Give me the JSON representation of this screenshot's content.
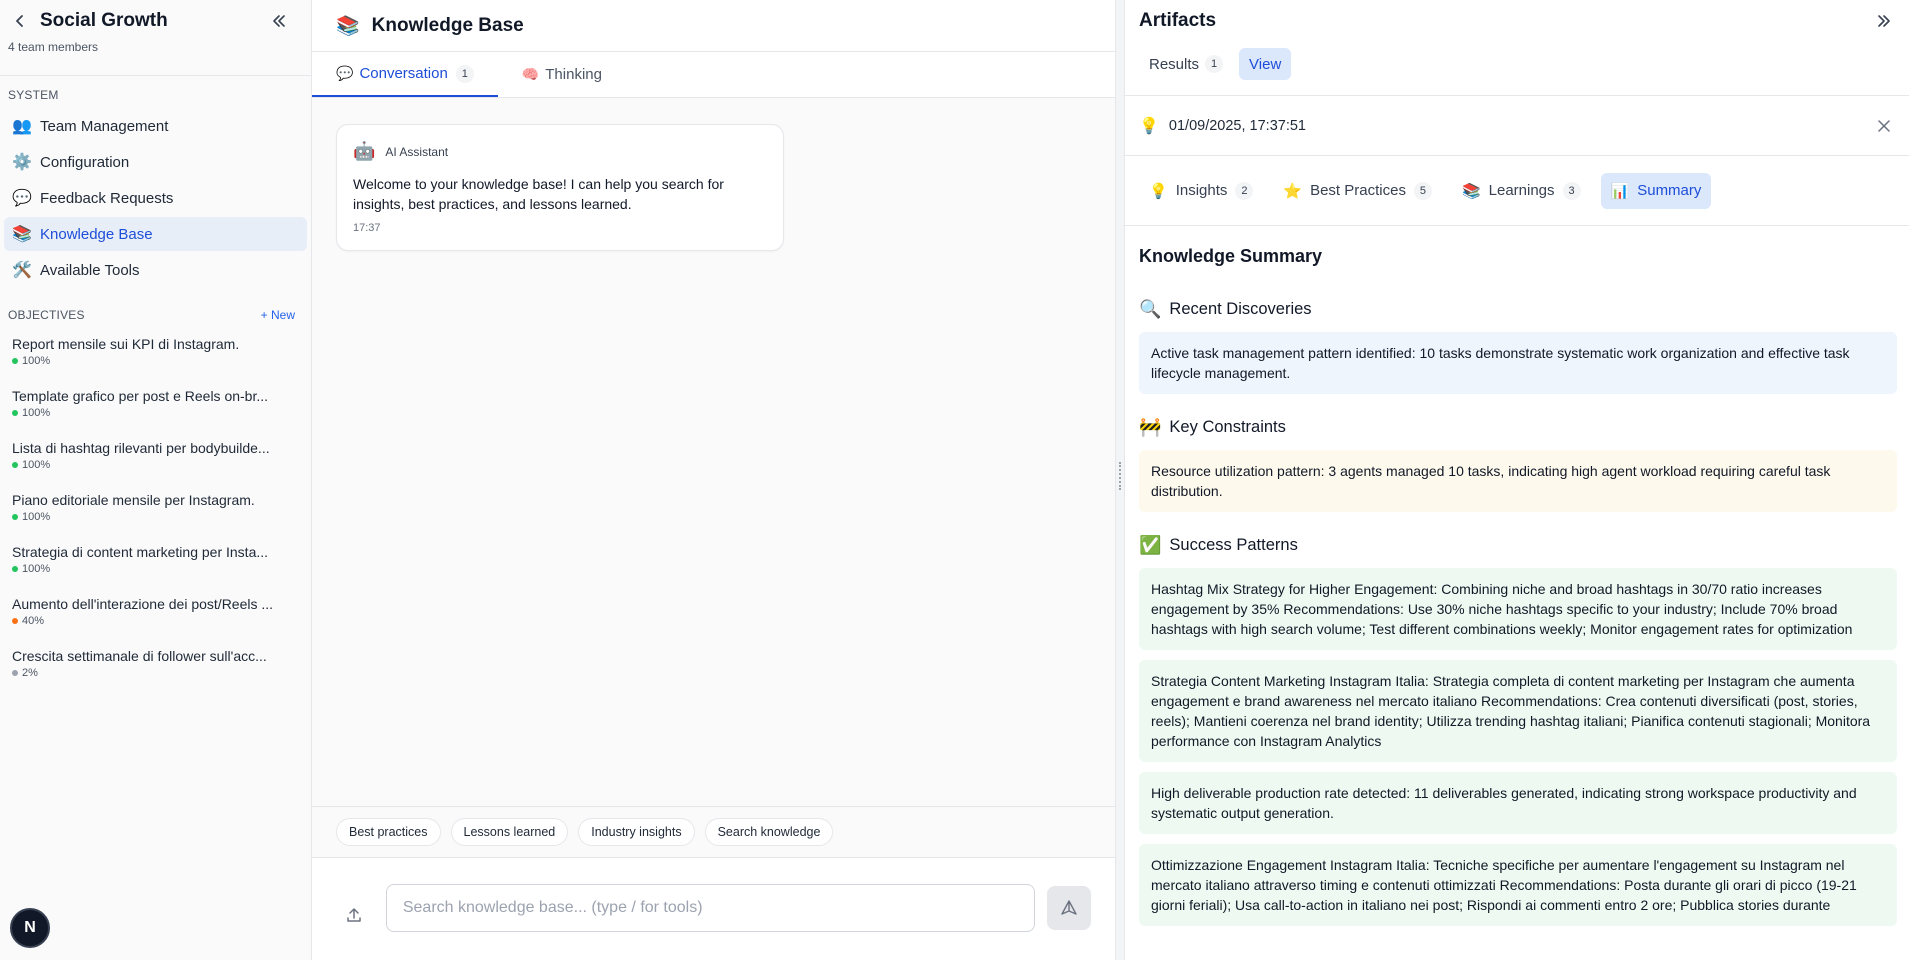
{
  "sidebar": {
    "title": "Social Growth",
    "members": "4 team members",
    "system_label": "SYSTEM",
    "nav": [
      {
        "icon": "👥",
        "icon_name": "team-icon",
        "label": "Team Management"
      },
      {
        "icon": "⚙️",
        "icon_name": "gear-icon",
        "label": "Configuration"
      },
      {
        "icon": "💬",
        "icon_name": "speech-bubble-icon",
        "label": "Feedback Requests"
      },
      {
        "icon": "📚",
        "icon_name": "books-icon",
        "label": "Knowledge Base"
      },
      {
        "icon": "🛠️",
        "icon_name": "tools-icon",
        "label": "Available Tools"
      }
    ],
    "objectives_label": "OBJECTIVES",
    "new_label": "+ New",
    "objectives": [
      {
        "title": "Report mensile sui KPI di Instagram.",
        "progress": "100%",
        "color": "#22c55e"
      },
      {
        "title": "Template grafico per post e Reels on-br...",
        "progress": "100%",
        "color": "#22c55e"
      },
      {
        "title": "Lista di hashtag rilevanti per bodybuilde...",
        "progress": "100%",
        "color": "#22c55e"
      },
      {
        "title": "Piano editoriale mensile per Instagram.",
        "progress": "100%",
        "color": "#22c55e"
      },
      {
        "title": "Strategia di content marketing per Insta...",
        "progress": "100%",
        "color": "#22c55e"
      },
      {
        "title": "Aumento dell'interazione dei post/Reels ...",
        "progress": "40%",
        "color": "#f97316"
      },
      {
        "title": "Crescita settimanale di follower sull'acc...",
        "progress": "2%",
        "color": "#9ca3af"
      }
    ],
    "avatar_letter": "N"
  },
  "main": {
    "icon": "📚",
    "title": "Knowledge Base",
    "tabs": [
      {
        "icon": "💬",
        "label": "Conversation",
        "count": "1"
      },
      {
        "icon": "🧠",
        "label": "Thinking"
      }
    ],
    "message": {
      "icon": "🤖",
      "author": "AI Assistant",
      "text": "Welcome to your knowledge base! I can help you search for insights, best practices, and lessons learned.",
      "time": "17:37"
    },
    "chips": [
      "Best practices",
      "Lessons learned",
      "Industry insights",
      "Search knowledge"
    ],
    "input_placeholder": "Search knowledge base... (type / for tools)"
  },
  "artifacts": {
    "title": "Artifacts",
    "tabs": [
      {
        "label": "Results",
        "count": "1"
      },
      {
        "label": "View"
      }
    ],
    "timestamp": "01/09/2025, 17:37:51",
    "sub_tabs": [
      {
        "icon": "💡",
        "label": "Insights",
        "count": "2"
      },
      {
        "icon": "⭐",
        "label": "Best Practices",
        "count": "5"
      },
      {
        "icon": "📚",
        "label": "Learnings",
        "count": "3"
      },
      {
        "icon": "📊",
        "label": "Summary"
      }
    ],
    "summary_title": "Knowledge Summary",
    "sections": {
      "discoveries": {
        "icon": "🔍",
        "title": "Recent Discoveries",
        "items": [
          "Active task management pattern identified: 10 tasks demonstrate systematic work organization and effective task lifecycle management."
        ]
      },
      "constraints": {
        "icon": "🚧",
        "title": "Key Constraints",
        "items": [
          "Resource utilization pattern: 3 agents managed 10 tasks, indicating high agent workload requiring careful task distribution."
        ]
      },
      "success": {
        "icon": "✅",
        "title": "Success Patterns",
        "items": [
          "Hashtag Mix Strategy for Higher Engagement: Combining niche and broad hashtags in 30/70 ratio increases engagement by 35% Recommendations: Use 30% niche hashtags specific to your industry; Include 70% broad hashtags with high search volume; Test different combinations weekly; Monitor engagement rates for optimization",
          "Strategia Content Marketing Instagram Italia: Strategia completa di content marketing per Instagram che aumenta engagement e brand awareness nel mercato italiano Recommendations: Crea contenuti diversificati (post, stories, reels); Mantieni coerenza nel brand identity; Utilizza trending hashtag italiani; Pianifica contenuti stagionali; Monitora performance con Instagram Analytics",
          "High deliverable production rate detected: 11 deliverables generated, indicating strong workspace productivity and systematic output generation.",
          "Ottimizzazione Engagement Instagram Italia: Tecniche specifiche per aumentare l'engagement su Instagram nel mercato italiano attraverso timing e contenuti ottimizzati Recommendations: Posta durante gli orari di picco (19-21 giorni feriali); Usa call-to-action in italiano nei post; Rispondi ai commenti entro 2 ore; Pubblica stories durante"
        ]
      }
    }
  }
}
